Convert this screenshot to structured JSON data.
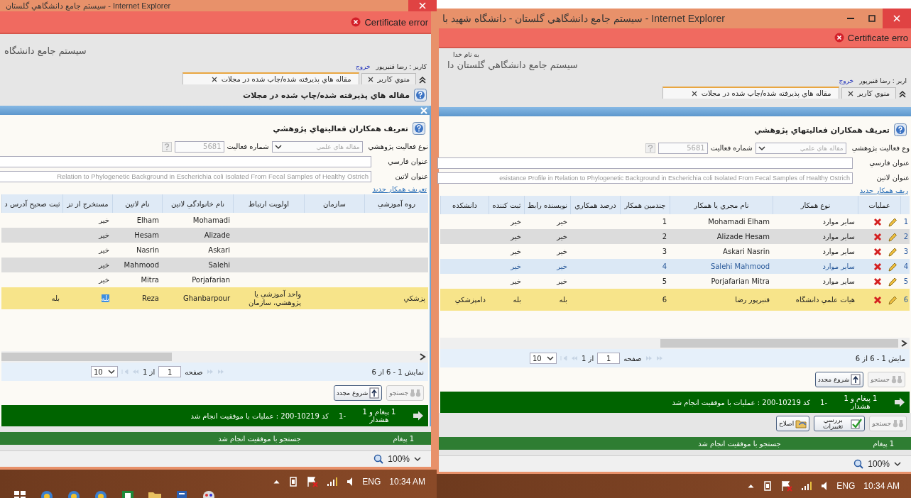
{
  "screens": [
    {
      "window": {
        "title": "سيستم جامع دانشگاهي گلستان - Internet Explorer",
        "buttons": [
          {
            "kind": "close"
          }
        ]
      },
      "certificate_error": "Certificate error",
      "header": {
        "site_title": "سيستم جامع دانشگاه",
        "user": "كاربر : رضا قنبرپور",
        "logout": "خروج"
      },
      "tabs": [
        {
          "label": "منوي كاربر",
          "selected": false
        },
        {
          "label": "مقاله هاي پذيرفته شده/چاپ شده در مجلات",
          "selected": true
        }
      ],
      "page_heading": "مقاله هاي پذيرفته شده/چاپ شده در مجلات",
      "dialog": {
        "close_button": true,
        "heading": "تعريف همكاران فعاليتهاي پژوهشي",
        "form": {
          "activity_type_label": "نوع فعاليت پژوهشي",
          "activity_type": {
            "value": "مقاله هاي علمي",
            "disabled": true
          },
          "activity_number_label": "شماره فعاليت",
          "activity_number": {
            "value": "5681",
            "disabled": true
          },
          "persian_title_label": "عنوان فارسي",
          "latin_title_label": "عنوان لاتين",
          "latin_title": "Relation to Phylogenetic Background in Escherichia coli Isolated From Fecal Samples of Healthy Ostrich"
        },
        "new_link": "تعريف همكار جديد",
        "table": {
          "columns": [
            "روه آموزشي",
            "سازمان",
            "اولويت ارتباط",
            "نام خانوادگي لاتين",
            "نام لاتين",
            "مستخرج از تز",
            "ثبت صحيح آدرس د"
          ],
          "rows": [
            {
              "cells": [
                "",
                "",
                "",
                "Mohamadi",
                "Elham",
                "خير",
                ""
              ],
              "selected": false,
              "hovered": false
            },
            {
              "cells": [
                "",
                "",
                "",
                "Alizade",
                "Hesam",
                "خير",
                ""
              ],
              "selected": false,
              "hovered": false
            },
            {
              "cells": [
                "",
                "",
                "",
                "Askari",
                "Nasrin",
                "خير",
                ""
              ],
              "selected": false,
              "hovered": false
            },
            {
              "cells": [
                "",
                "",
                "",
                "Salehi",
                "Mahmood",
                "خير",
                ""
              ],
              "selected": false,
              "hovered": false
            },
            {
              "cells": [
                "",
                "",
                "",
                "Porjafarian",
                "Mitra",
                "خير",
                ""
              ],
              "selected": false,
              "hovered": false
            },
            {
              "cells": [
                "پزشكي",
                "",
                "واحد آموزشي يا پژوهشي، سازمان",
                "Ghanbarpour",
                "Reza",
                {
                  "text": "بله",
                  "highlighted": true
                },
                "بله"
              ],
              "selected": true,
              "hovered": false
            }
          ]
        },
        "pager": {
          "summary": "نمايش 1 - 6 از 6",
          "page_label": "صفحه",
          "page": "1",
          "total": "از 1",
          "page_size": "10"
        },
        "buttons": [
          {
            "kind": "search",
            "label": "جستجو",
            "disabled": true
          },
          {
            "kind": "reset",
            "label": "شروع مجدد",
            "disabled": false
          }
        ],
        "message": {
          "count": "1 پيغام و 1 هشدار",
          "index": "-1",
          "text": "كد 10219-200 : عمليات با موفقيت انجام شد"
        }
      },
      "message": {
        "count": "1 پيغام",
        "text": "جستجو با موفقيت انجام شد"
      },
      "zoom": "100%",
      "taskbar": {
        "apps": [
          {
            "kind": "start"
          },
          {
            "kind": "browser"
          },
          {
            "kind": "browser"
          },
          {
            "kind": "browser"
          },
          {
            "kind": "spreadsheet"
          },
          {
            "kind": "folder"
          },
          {
            "kind": "document"
          },
          {
            "kind": "paint"
          }
        ],
        "language": "ENG",
        "time": "10:34 AM"
      }
    },
    {
      "window": {
        "title": "سيستم جامع دانشگاهي گلستان - دانشگاه شهيد با - Internet Explorer",
        "buttons": [
          {
            "kind": "minimize"
          },
          {
            "kind": "maximize"
          },
          {
            "kind": "close"
          }
        ]
      },
      "certificate_error": "Certificate erro",
      "header": {
        "greeting": "به نام خدا",
        "site_title": "سيستم جامع دانشگاهي گلستان  دا",
        "user": "اربر : رضا قنبرپور",
        "logout": "خروج"
      },
      "tabs": [
        {
          "label": "منوي كاربر",
          "selected": false
        },
        {
          "label": "مقاله هاي پذيرفته شده/چاپ شده در مجلات",
          "selected": true
        }
      ],
      "dialog": {
        "close_button": false,
        "heading": "تعريف همكاران فعاليتهاي پژوهشي",
        "form": {
          "activity_type_label": "وع فعاليت پژوهشي",
          "activity_type": {
            "value": "مقاله هاي علمي",
            "disabled": true
          },
          "activity_number_label": "شماره فعاليت",
          "activity_number": {
            "value": "5681",
            "disabled": true
          },
          "persian_title_label": "عنوان فارسي",
          "latin_title_label": "عنوان لاتين",
          "latin_title": "esistance Profile in Relation to Phylogenetic Background in Escherichia coli Isolated From Fecal Samples of Healthy Ostrich"
        },
        "new_link": "ريف همكار جديد",
        "table": {
          "actions_header": "عمليات",
          "columns": [
            "نوع همكار",
            "نام مجري يا همكار",
            "چندمين همكار",
            "درصد همكاري",
            "نويسنده رابط",
            "ثبت كننده",
            "دانشكده"
          ],
          "rows": [
            {
              "number": "1",
              "cells": [
                "ساير موارد",
                "Mohamadi Elham",
                "1",
                "",
                "خير",
                "خير",
                ""
              ],
              "selected": false,
              "hovered": false
            },
            {
              "number": "2",
              "cells": [
                "ساير موارد",
                "Alizade Hesam",
                "2",
                "",
                "خير",
                "خير",
                ""
              ],
              "selected": false,
              "hovered": false
            },
            {
              "number": "3",
              "cells": [
                "ساير موارد",
                "Askari Nasrin",
                "3",
                "",
                "خير",
                "خير",
                ""
              ],
              "selected": false,
              "hovered": false
            },
            {
              "number": "4",
              "cells": [
                "ساير موارد",
                "Salehi Mahmood",
                "4",
                "",
                "خير",
                "خير",
                ""
              ],
              "selected": false,
              "hovered": true
            },
            {
              "number": "5",
              "cells": [
                "ساير موارد",
                "Porjafarian Mitra",
                "5",
                "",
                "خير",
                "خير",
                ""
              ],
              "selected": false,
              "hovered": false
            },
            {
              "number": "6",
              "cells": [
                "هيات علمي دانشگاه",
                "قنبرپور رضا",
                "6",
                "",
                "بله",
                "بله",
                "دامپزشكي"
              ],
              "selected": true,
              "hovered": false
            }
          ]
        },
        "pager": {
          "summary": "مايش 1 - 6 از 6",
          "page_label": "صفحه",
          "page": "1",
          "total": "از 1",
          "page_size": "10"
        },
        "buttons": [
          {
            "kind": "search",
            "label": "جستجو",
            "disabled": true
          },
          {
            "kind": "reset",
            "label": "شروع مجدد",
            "disabled": false
          }
        ],
        "message": {
          "count": "1 پيغام و 1 هشدار",
          "index": "-1",
          "text": "كد 10219-200 : عمليات با موفقيت انجام شد"
        }
      },
      "buttons": [
        {
          "kind": "search",
          "label": "جستجو",
          "disabled": true
        },
        {
          "kind": "review",
          "label": "بررسي تغييرات",
          "disabled": false
        },
        {
          "kind": "edit",
          "label": "اصلاح",
          "disabled": false
        }
      ],
      "message": {
        "count": "1 پيغام",
        "text": "جستجو با موفقيت انجام شد"
      },
      "zoom": "100%",
      "taskbar": {
        "language": "ENG",
        "time": "10:34 AM"
      }
    }
  ]
}
